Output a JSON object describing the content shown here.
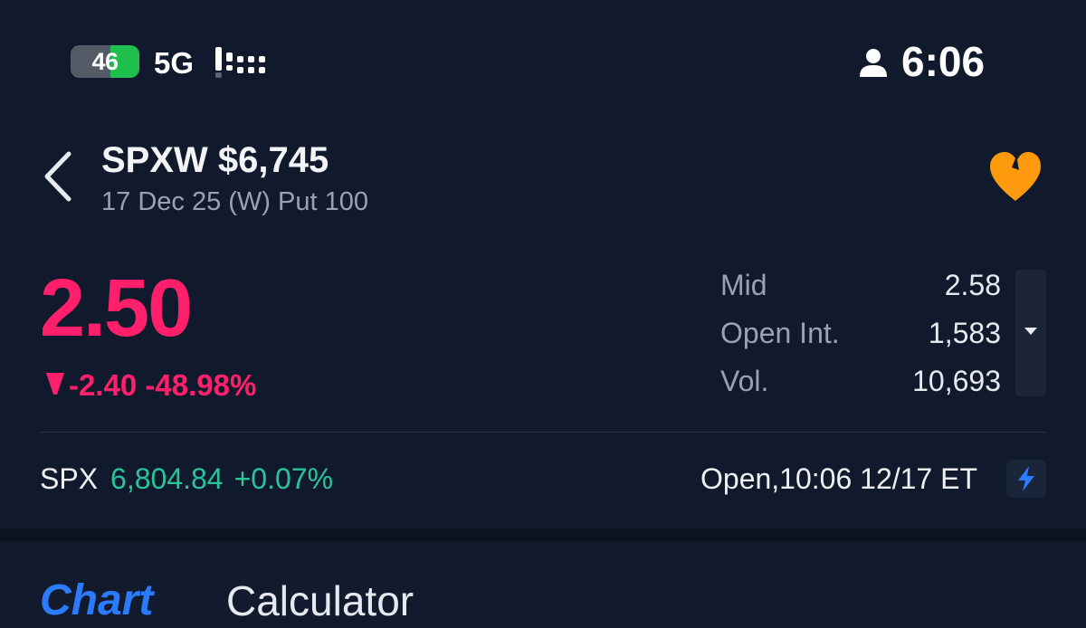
{
  "status_bar": {
    "battery_level": "46",
    "network": "5G",
    "time": "6:06"
  },
  "header": {
    "title": "SPXW $6,745",
    "subtitle": "17 Dec 25 (W) Put 100"
  },
  "quote": {
    "price": "2.50",
    "change": "-2.40",
    "change_pct": "-48.98%",
    "color_negative": "#ff1f6a",
    "color_positive": "#29c49a"
  },
  "stats": [
    {
      "label": "Mid",
      "value": "2.58"
    },
    {
      "label": "Open Int.",
      "value": "1,583"
    },
    {
      "label": "Vol.",
      "value": "10,693"
    }
  ],
  "underlying": {
    "symbol": "SPX",
    "price": "6,804.84",
    "change_pct": "+0.07%"
  },
  "market_status": "Open,10:06 12/17 ET",
  "tabs": [
    {
      "label": "Chart",
      "active": true
    },
    {
      "label": "Calculator",
      "active": false
    }
  ],
  "icons": {
    "back": "chevron-left-icon",
    "favorite": "heart-icon",
    "expand": "caret-down-icon",
    "bolt": "lightning-icon",
    "person": "person-icon"
  }
}
